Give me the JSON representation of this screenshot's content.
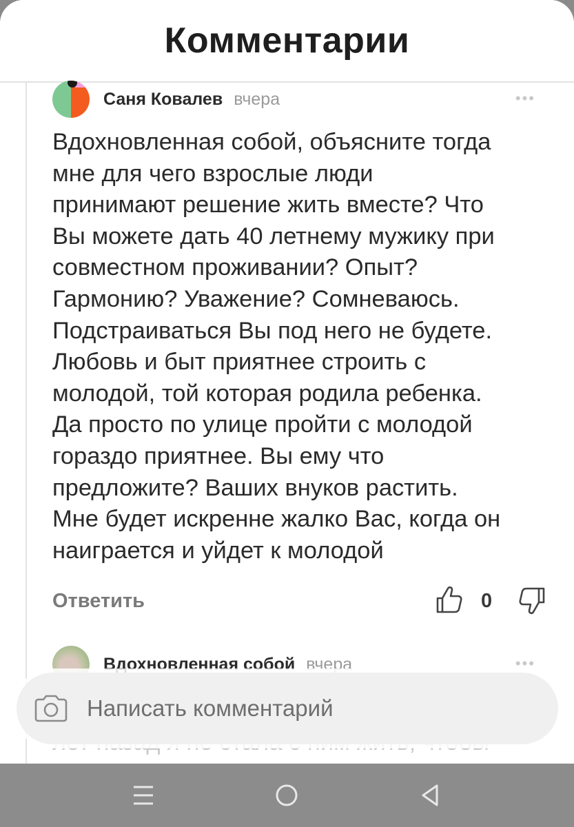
{
  "sheet": {
    "title": "Комментарии"
  },
  "comments": [
    {
      "author": "Саня Ковалев",
      "time": "вчера",
      "menu_icon": "more-dots-icon",
      "text": "Вдохновленная собой, объясните тогда\nмне для чего взрослые люди\nпринимают решение жить вместе? Что\nВы можете дать 40 летнему мужику при\nсовместном проживании? Опыт?\nГармонию? Уважение? Сомневаюсь.\nПодстраиваться Вы под него не будете.\nЛюбовь и быт приятнее строить с\nмолодой, той которая родила ребенка.\nДа просто по улице пройти с молодой\nгораздо приятнее. Вы ему что\nпредложите? Ваших внуков растить.\nМне будет искренне жалко Вас, когда он\nнаиграется и уйдет к молодой",
      "reply_label": "Ответить",
      "likes": "0",
      "like_icon": "thumbs-up-icon",
      "dislike_icon": "thumbs-down-icon"
    },
    {
      "author": "Вдохновленная собой",
      "time": "вчера",
      "menu_icon": "more-dots-icon",
      "text_partial": "лет назад я не стала с ним жить, чтобы"
    }
  ],
  "composer": {
    "placeholder": "Написать комментарий",
    "icon": "camera-icon"
  },
  "navbar": {
    "icons": [
      "menu-icon",
      "home-icon",
      "back-icon"
    ]
  },
  "colors": {
    "avatar_green": "#7ec993",
    "avatar_orange": "#f45b1e",
    "navbar": "#8c8c8c"
  }
}
